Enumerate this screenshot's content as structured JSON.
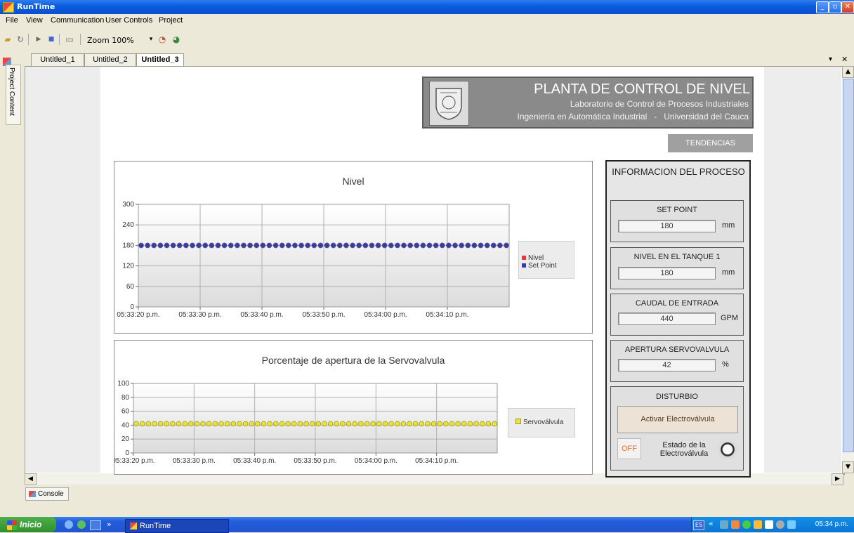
{
  "window": {
    "title": "RunTime"
  },
  "menu": [
    "File",
    "View",
    "Communication",
    "User Controls",
    "Project"
  ],
  "toolbar": {
    "zoom_label": "Zoom 100%"
  },
  "sidebar": {
    "label": "Project Content"
  },
  "tabs": [
    {
      "label": "Untitled_1",
      "active": false
    },
    {
      "label": "Untitled_2",
      "active": false
    },
    {
      "label": "Untitled_3",
      "active": true
    }
  ],
  "header": {
    "title": "PLANTA DE CONTROL DE NIVEL",
    "subtitle1": "Laboratorio de Control de Procesos Industriales",
    "subtitle2": "Ingeniería en Automática Industrial   -   Universidad del Cauca",
    "tendencias_label": "TENDENCIAS"
  },
  "chart_data": [
    {
      "type": "scatter",
      "title": "Nivel",
      "ylim": [
        0,
        300
      ],
      "yticks": [
        "300",
        "240",
        "180",
        "120",
        "60",
        "0"
      ],
      "xticks": [
        "05:33:20 p.m.",
        "05:33:30 p.m.",
        "05:33:40 p.m.",
        "05:33:50 p.m.",
        "05:34:00 p.m.",
        "05:34:10 p.m."
      ],
      "points_count": 58,
      "series": [
        {
          "name": "Nivel",
          "color": "#e23a3a",
          "value": 180
        },
        {
          "name": "Set Point",
          "color": "#3a3aa8",
          "value": 180
        }
      ],
      "grid": true,
      "legend": "right"
    },
    {
      "type": "scatter",
      "title": "Porcentaje de apertura de la Servovalvula",
      "ylim": [
        0,
        100
      ],
      "yticks": [
        "100",
        "80",
        "60",
        "40",
        "20",
        "0"
      ],
      "xticks": [
        "05:33:20 p.m.",
        "05:33:30 p.m.",
        "05:33:40 p.m.",
        "05:33:50 p.m.",
        "05:34:00 p.m.",
        "05:34:10 p.m."
      ],
      "points_count": 60,
      "series": [
        {
          "name": "Servoválvula",
          "color": "#e8e23a",
          "value": 42
        }
      ],
      "grid": true,
      "legend": "right"
    }
  ],
  "panel": {
    "title": "INFORMACION DEL PROCESO",
    "setpoint": {
      "label": "SET POINT",
      "value": "180",
      "unit": "mm"
    },
    "nivel": {
      "label": "NIVEL EN EL TANQUE 1",
      "value": "180",
      "unit": "mm"
    },
    "caudal": {
      "label": "CAUDAL DE ENTRADA",
      "value": "440",
      "unit": "GPM"
    },
    "apertura": {
      "label": "APERTURA SERVOVALVULA",
      "value": "42",
      "unit": "%"
    },
    "disturbio": {
      "label": "DISTURBIO",
      "button": "Activar Electroválvula",
      "off_label": "OFF",
      "estado": "Estado de la Electroválvula"
    }
  },
  "console": {
    "label": "Console"
  },
  "taskbar": {
    "start": "Inicio",
    "task": "RunTime",
    "lang": "ES",
    "clock": "05:34 p.m."
  }
}
